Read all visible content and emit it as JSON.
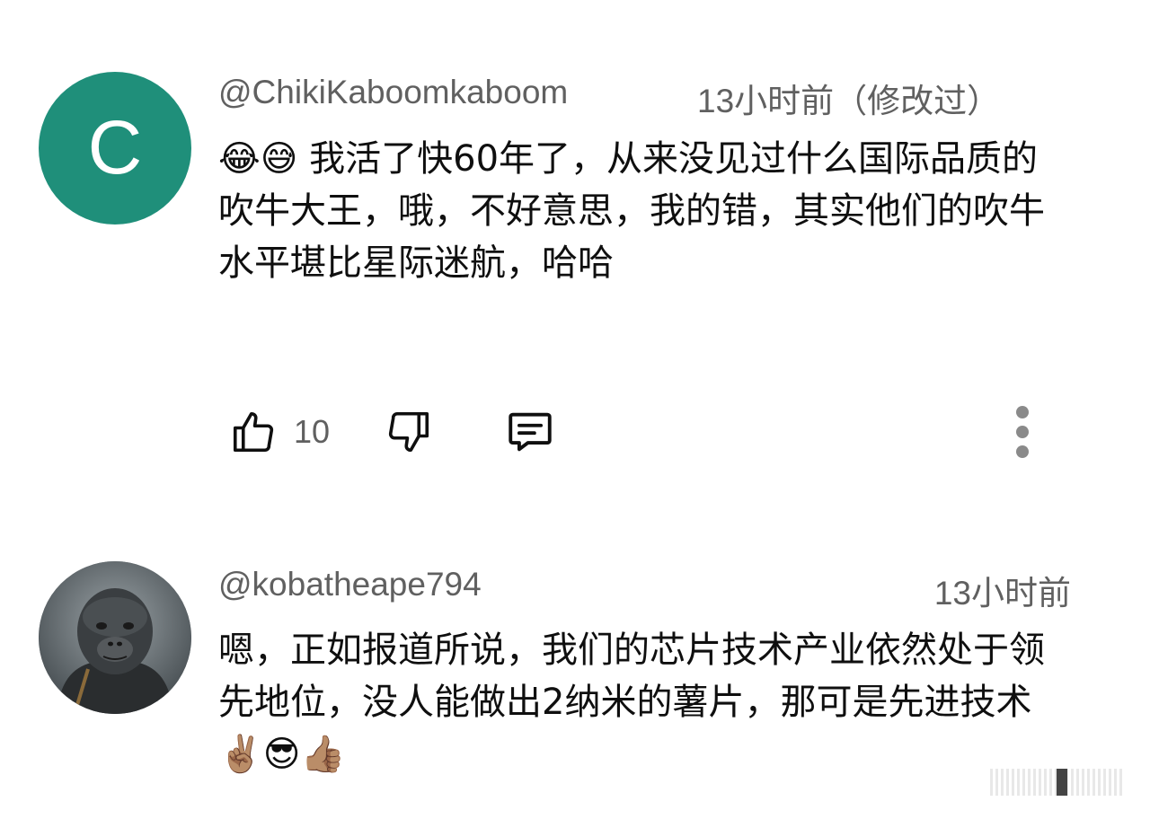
{
  "comments": [
    {
      "avatar_letter": "C",
      "avatar_color": "#1f8f7a",
      "handle": "@ChikiKaboomkaboom",
      "time": "13小时前（修改过）",
      "emoji_prefix": "😂😅",
      "text": " 我活了快60年了，从来没见过什么国际品质的吹牛大王，哦，不好意思，我的错，其实他们的吹牛水平堪比星际迷航，哈哈",
      "likes": "10",
      "icons": [
        "thumbs-up-icon",
        "thumbs-down-icon",
        "reply-icon",
        "more-vert-icon"
      ]
    },
    {
      "avatar_desc_icon": "ape-avatar",
      "handle": "@kobatheape794",
      "time": "13小时前",
      "text": "嗯，正如报道所说，我们的芯片技术产业依然处于领先地位，没人能做出2纳米的薯片，那可是先进技术",
      "emoji_suffix": "✌🏽😎👍🏽"
    }
  ]
}
